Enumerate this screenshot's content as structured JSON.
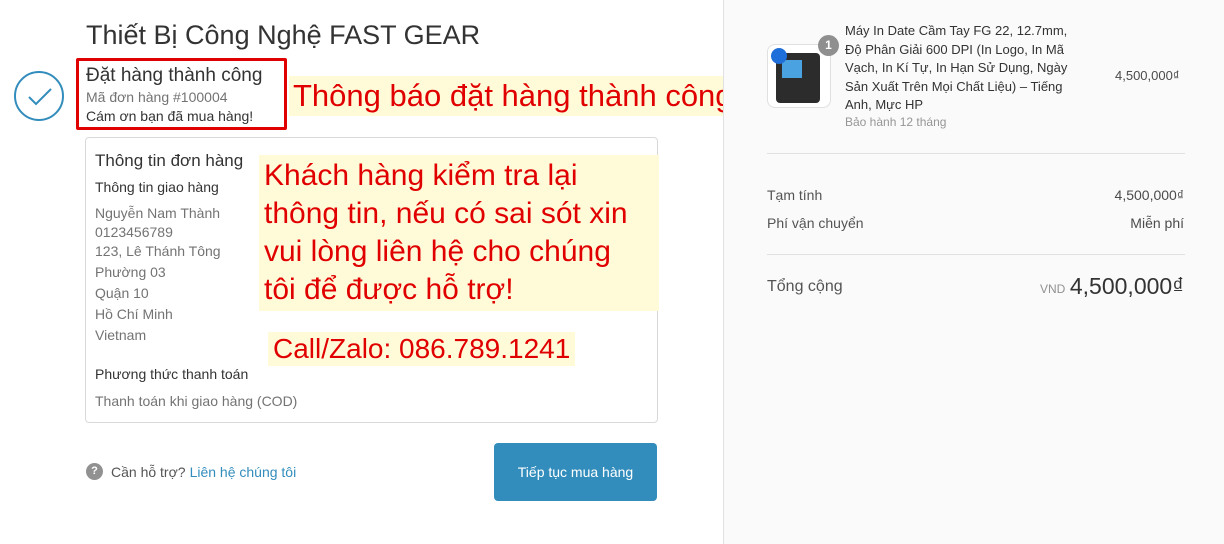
{
  "shop_title": "Thiết Bị Công Nghệ FAST GEAR",
  "confirmation": {
    "title": "Đặt hàng thành công",
    "order_code": "Mã đơn hàng #100004",
    "thanks": "Cám ơn bạn đã mua hàng!"
  },
  "annotations": {
    "success_note": "Thông báo đặt hàng thành công",
    "check_note_lines": [
      "Khách hàng kiểm tra lại",
      "thông tin, nếu có sai sót xin",
      "vui lòng liên hệ cho chúng",
      "tôi để được hỗ trợ!"
    ],
    "contact": "Call/Zalo: 086.789.1241",
    "accent_color": "#e00000",
    "highlight_color": "#fffbd9"
  },
  "order_info": {
    "title": "Thông tin đơn hàng",
    "shipping_label": "Thông tin giao hàng",
    "shipping_lines": [
      "Nguyễn Nam Thành",
      "0123456789",
      "123, Lê Thánh Tông",
      "Phường 03",
      "Quận 10",
      "Hồ Chí Minh",
      "Vietnam"
    ],
    "payment_label": "Phương thức thanh toán",
    "payment_method": "Thanh toán khi giao hàng (COD)"
  },
  "help": {
    "icon": "question-icon",
    "icon_glyph": "?",
    "text": "Cần hỗ trợ?",
    "link": "Liên hệ chúng tôi"
  },
  "continue_button": "Tiếp tục mua hàng",
  "brand_color": "#338dbc",
  "cart": {
    "item": {
      "quantity": "1",
      "name_lines": [
        "Máy In Date Cầm Tay FG 22, 12.7mm,",
        "Độ Phân Giải 600 DPI (In Logo, In Mã",
        "Vạch, In Kí Tự, In Hạn Sử Dụng, Ngày",
        "Sản Xuất Trên Mọi Chất Liệu) – Tiếng",
        "Anh, Mực HP"
      ],
      "warranty": "Bảo hành 12 tháng",
      "price": "4,500,000₫"
    },
    "subtotal_label": "Tạm tính",
    "subtotal": "4,500,000₫",
    "shipping_label": "Phí vận chuyển",
    "shipping": "Miễn phí",
    "total_label": "Tổng cộng",
    "currency": "VND",
    "total": "4,500,000₫"
  }
}
